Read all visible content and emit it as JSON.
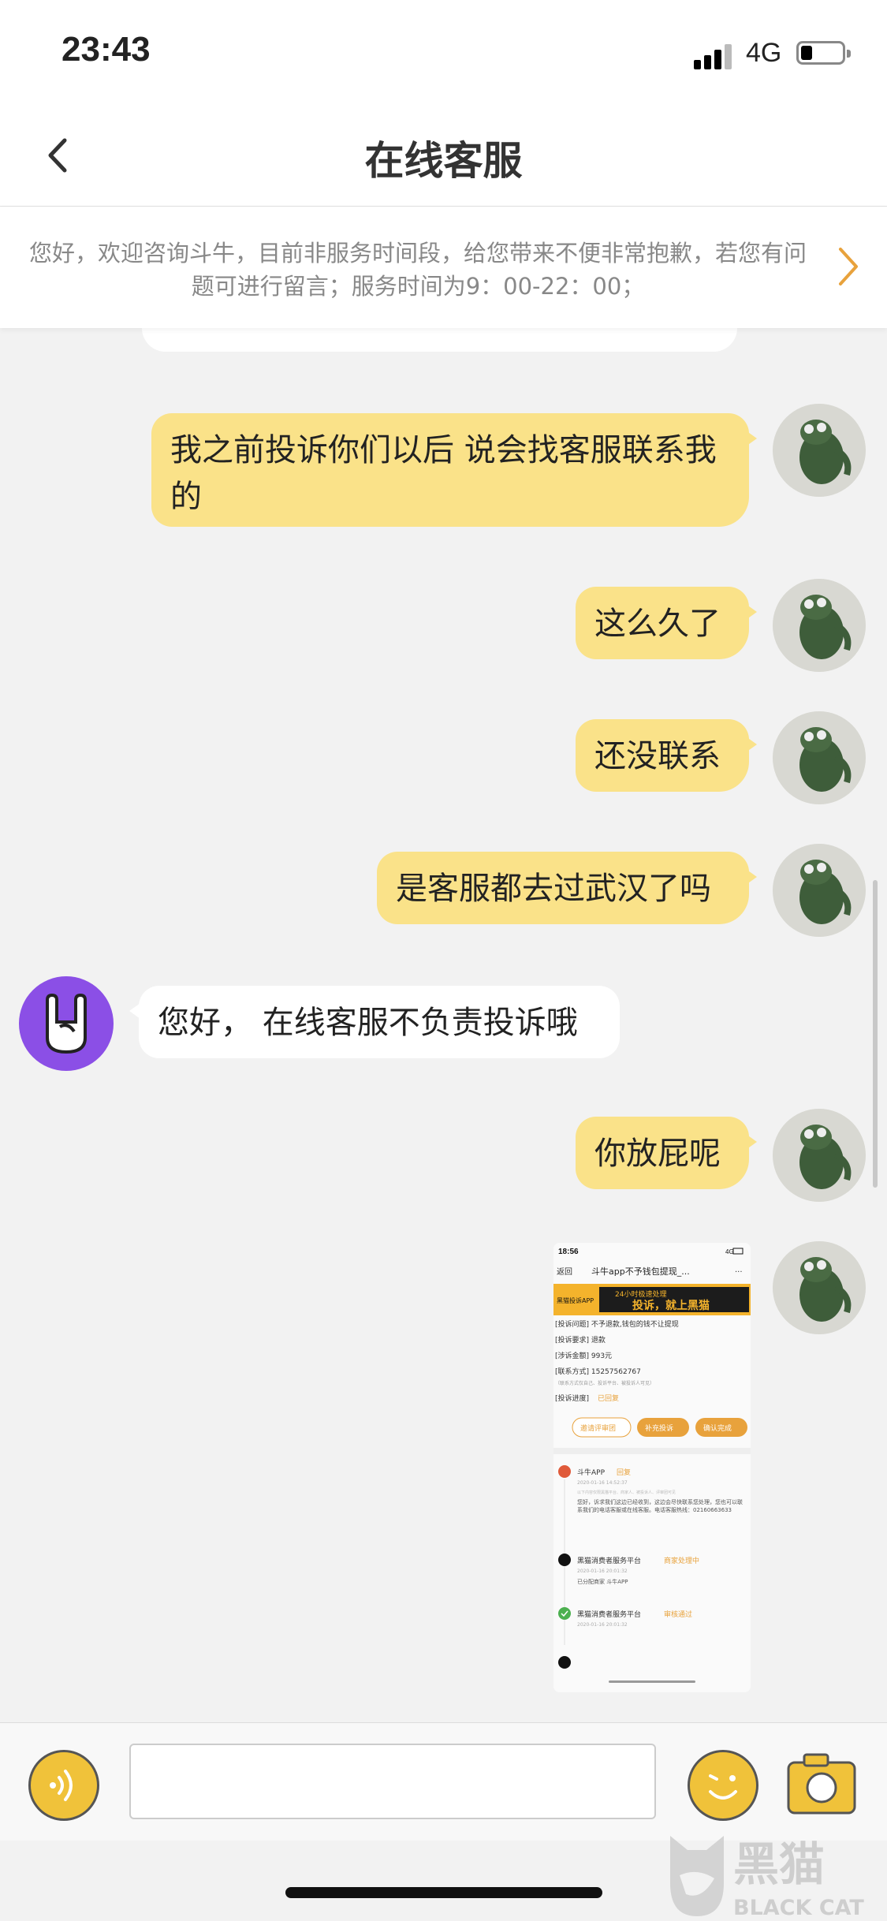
{
  "status_bar": {
    "time": "23:43",
    "network": "4G"
  },
  "nav": {
    "title": "在线客服"
  },
  "notice": {
    "text": "您好，欢迎咨询斗牛，目前非服务时间段，给您带来不便非常抱歉，若您有问题可进行留言；服务时间为9：00-22：00；"
  },
  "messages": [
    {
      "sender": "user",
      "text": "我之前投诉你们以后 说会找客服联系我的"
    },
    {
      "sender": "user",
      "text": "这么久了"
    },
    {
      "sender": "user",
      "text": "还没联系"
    },
    {
      "sender": "user",
      "text": "是客服都去过武汉了吗"
    },
    {
      "sender": "agent",
      "text": "您好， 在线客服不负责投诉哦"
    },
    {
      "sender": "user",
      "text": "你放屁呢"
    }
  ],
  "image_message": {
    "time": "18:56",
    "network": "4G",
    "back": "返回",
    "title": "斗牛app不予钱包提现_...",
    "menu": "···",
    "banner_left": "黑猫投诉APP",
    "banner_right_top": "24小时极速处理",
    "banner_right": "投诉，就上黑猫",
    "line1": "[投诉问题] 不予退款,钱包的钱不让提现",
    "line2": "[投诉要求] 退款",
    "line3": "[涉诉金额] 993元",
    "line4_label": "[联系方式] 15257562767",
    "line4_note": "（联系方式仅自己、投诉平台、被投诉人可见）",
    "line5_label": "[投诉进度]",
    "line5_status": "已回复",
    "btn1": "邀请评审团",
    "btn2": "补充投诉",
    "btn3": "确认完成",
    "entry1_name": "斗牛APP",
    "entry1_tag": "回复",
    "entry1_time": "2020-01-16 14:52:37",
    "entry1_note": "以下内容仅限黑猫平台、商家人、被投诉人、评审团可见",
    "entry1_text": "您好，诉求我们这边已经收到，这边会尽快联系您处理，您也可以联系我们的电话客服或在线客服。电话客服热线：02160663633",
    "entry2_name": "黑猫消费者服务平台",
    "entry2_tag": "商家处理中",
    "entry2_time": "2020-01-16 20:01:32",
    "entry2_text": "已分配商家 斗牛APP",
    "entry3_name": "黑猫消费者服务平台",
    "entry3_tag": "审核通过",
    "entry3_time": "2020-01-16 20:01:32"
  },
  "input": {
    "placeholder": ""
  },
  "watermark": {
    "cn": "黑猫",
    "en": "BLACK CAT"
  },
  "colors": {
    "user_bubble": "#fae289",
    "agent_bubble": "#ffffff",
    "accent": "#f0c23a",
    "agent_avatar": "#8b4fe6",
    "chevron": "#e8a23c"
  }
}
